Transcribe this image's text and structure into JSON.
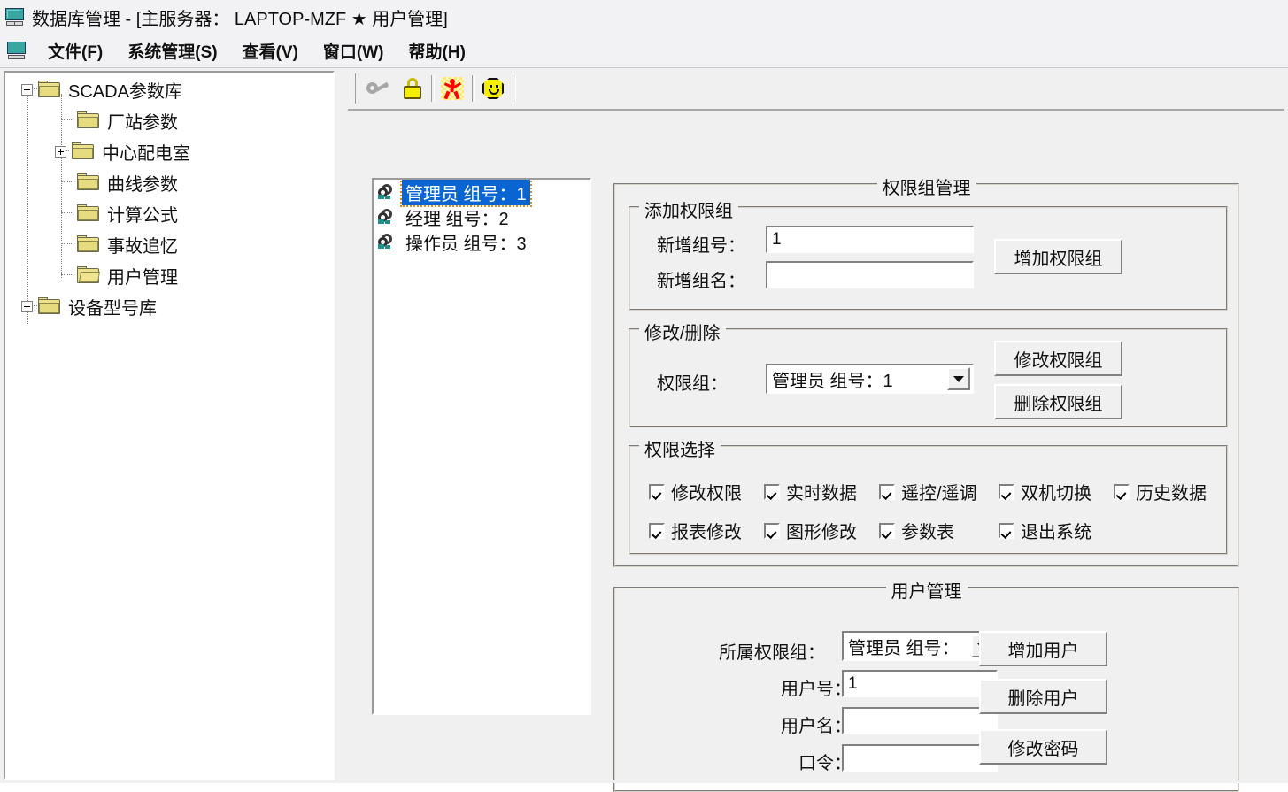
{
  "window": {
    "title": "数据库管理 - [主服务器： LAPTOP-MZF ★ 用户管理]",
    "icon": "monitor-icon"
  },
  "menubar": {
    "items": [
      {
        "label": "文件(F)",
        "name": "menu-file"
      },
      {
        "label": "系统管理(S)",
        "name": "menu-system"
      },
      {
        "label": "查看(V)",
        "name": "menu-view"
      },
      {
        "label": "窗口(W)",
        "name": "menu-window"
      },
      {
        "label": "帮助(H)",
        "name": "menu-help"
      }
    ]
  },
  "toolbar": {
    "buttons": [
      {
        "icon": "key-icon",
        "name": "toolbar-key"
      },
      {
        "icon": "lock-icon",
        "name": "toolbar-lock"
      },
      {
        "icon": "running-man-icon",
        "name": "toolbar-run"
      },
      {
        "icon": "smiley-icon",
        "name": "toolbar-smiley"
      }
    ]
  },
  "tree": {
    "root": "SCADA参数库",
    "nodes": [
      {
        "label": "SCADA参数库",
        "level": 0,
        "expander": "minus",
        "folder": "closed"
      },
      {
        "label": "厂站参数",
        "level": 1,
        "expander": "none",
        "folder": "closed"
      },
      {
        "label": "中心配电室",
        "level": 1,
        "expander": "plus",
        "folder": "closed"
      },
      {
        "label": "曲线参数",
        "level": 1,
        "expander": "none",
        "folder": "closed"
      },
      {
        "label": "计算公式",
        "level": 1,
        "expander": "none",
        "folder": "closed"
      },
      {
        "label": "事故追忆",
        "level": 1,
        "expander": "none",
        "folder": "closed"
      },
      {
        "label": "用户管理",
        "level": 1,
        "expander": "none",
        "folder": "open"
      },
      {
        "label": "设备型号库",
        "level": 0,
        "expander": "plus",
        "folder": "closed"
      }
    ]
  },
  "group_list": {
    "items": [
      {
        "label": "管理员 组号：1",
        "selected": true
      },
      {
        "label": "经理 组号：2",
        "selected": false
      },
      {
        "label": "操作员 组号：3",
        "selected": false
      }
    ]
  },
  "permission_group_panel": {
    "title": "权限组管理",
    "add_group": {
      "title": "添加权限组",
      "group_no_label": "新增组号：",
      "group_no_value": "1",
      "group_name_label": "新增组名：",
      "group_name_value": "",
      "add_button": "增加权限组"
    },
    "modify_delete": {
      "title": "修改/删除",
      "group_label": "权限组：",
      "group_value": "管理员 组号：1",
      "modify_button": "修改权限组",
      "delete_button": "删除权限组"
    },
    "permission_select": {
      "title": "权限选择",
      "row1": [
        {
          "label": "修改权限",
          "checked": true
        },
        {
          "label": "实时数据",
          "checked": true
        },
        {
          "label": "遥控/遥调",
          "checked": true
        },
        {
          "label": "双机切换",
          "checked": true
        },
        {
          "label": "历史数据",
          "checked": true
        }
      ],
      "row2": [
        {
          "label": "报表修改",
          "checked": true
        },
        {
          "label": "图形修改",
          "checked": true
        },
        {
          "label": "参数表",
          "checked": true
        },
        {
          "label": "退出系统",
          "checked": true
        }
      ]
    }
  },
  "user_panel": {
    "title": "用户管理",
    "group_label": "所属权限组：",
    "group_value": "管理员 组号：",
    "user_no_label": "用户号：",
    "user_no_value": "1",
    "user_name_label": "用户名：",
    "user_name_value": "",
    "password_label": "口令：",
    "password_value": "",
    "add_user_button": "增加用户",
    "delete_user_button": "删除用户",
    "change_password_button": "修改密码"
  },
  "colors": {
    "selection_blue": "#0a64d2",
    "focus_orange": "#e08a1e",
    "face": "#f0f0f0",
    "folder_yellow": "#ece08a"
  }
}
